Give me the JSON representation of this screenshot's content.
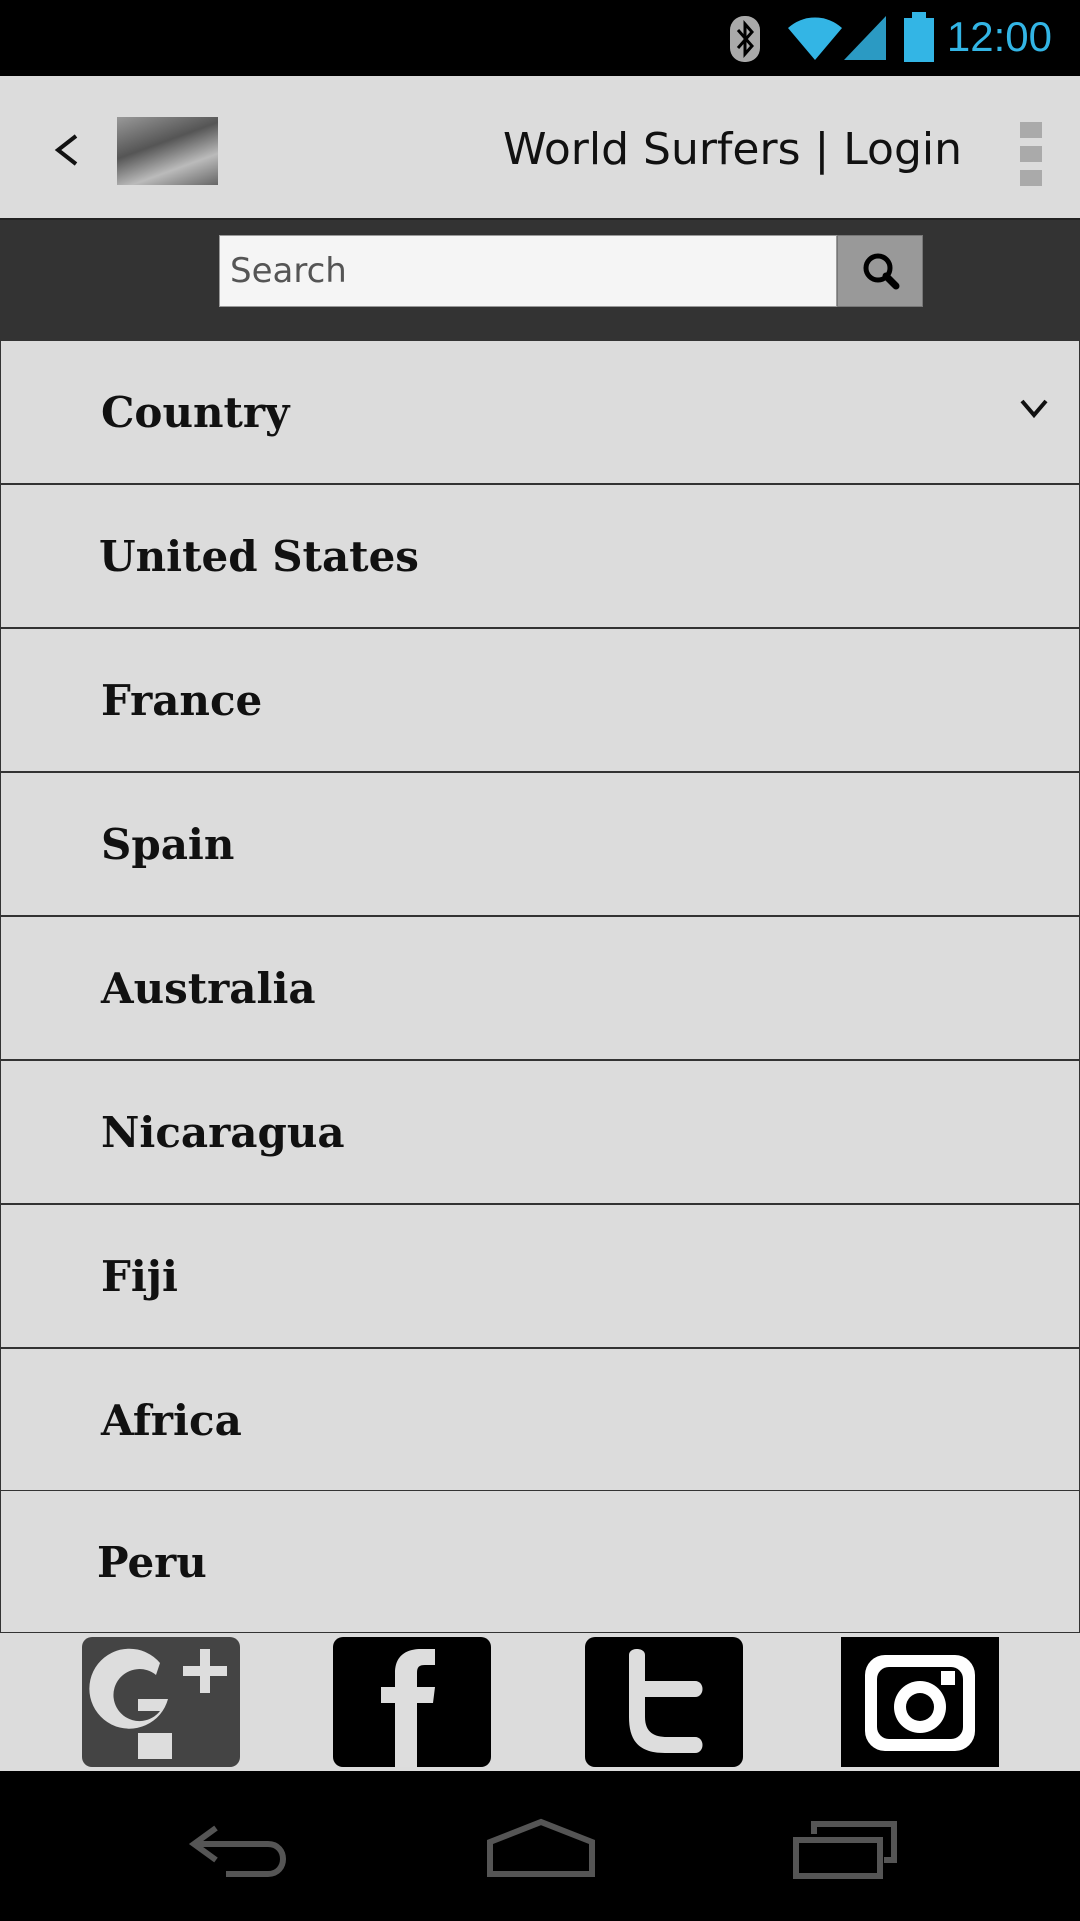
{
  "status_bar": {
    "time": "12:00"
  },
  "app_bar": {
    "title": "World Surfers | Login"
  },
  "search": {
    "placeholder": "Search"
  },
  "list": {
    "header": "Country",
    "items": [
      "United States",
      "France",
      "Spain",
      "Australia",
      "Nicaragua",
      "Fiji",
      "Africa",
      "Peru"
    ]
  },
  "social": [
    "google-plus",
    "facebook",
    "twitter",
    "instagram"
  ],
  "colors": {
    "status_accent": "#33b5e5",
    "toolbar_dark": "#333333",
    "list_bg": "#dcdcdc"
  }
}
